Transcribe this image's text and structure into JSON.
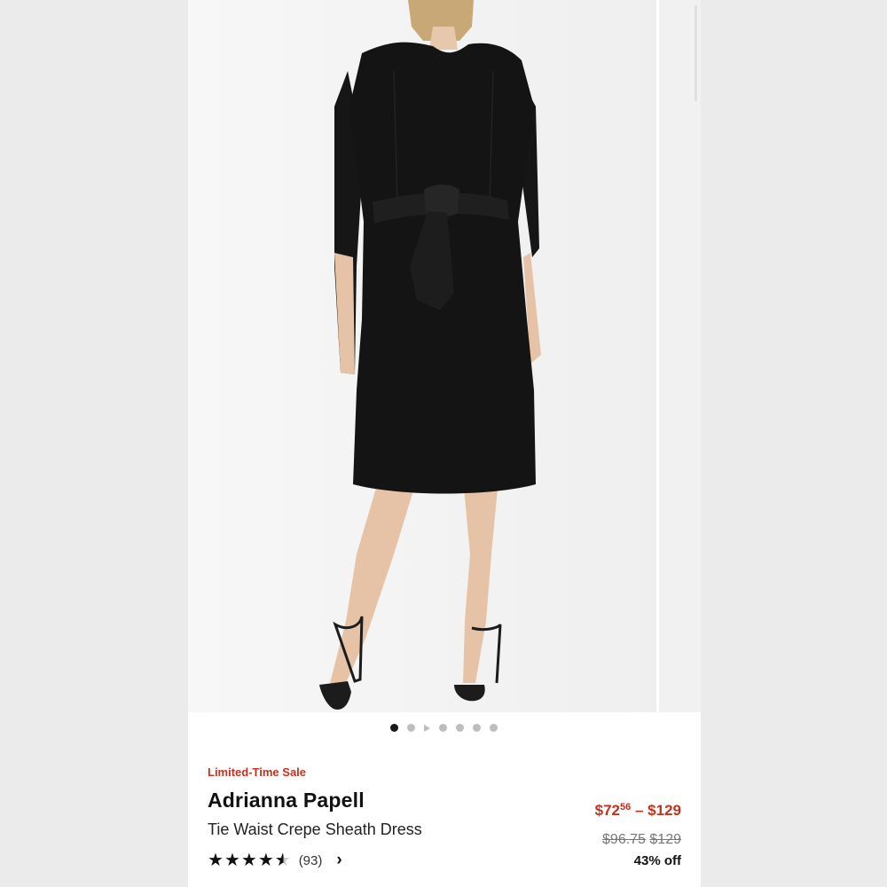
{
  "gallery": {
    "image_alt": "Woman wearing a black tie waist crepe sheath dress with black strappy sandals",
    "dot_count": 7,
    "active_dot": 0,
    "video_dot": 2
  },
  "product": {
    "sale_tag": "Limited-Time Sale",
    "brand": "Adrianna Papell",
    "name": "Tie Waist Crepe Sheath Dress"
  },
  "rating": {
    "stars": 4.5,
    "count": "(93)"
  },
  "price": {
    "sale_low_dollars": "$72",
    "sale_low_cents": "56",
    "separator": "–",
    "sale_high": "$129",
    "orig_low": "$96.75",
    "orig_high": "$129",
    "discount": "43% off"
  },
  "colors": {
    "sale_red": "#c4311d",
    "text_dark": "#111111",
    "dot_inactive": "#bdbdbd"
  }
}
